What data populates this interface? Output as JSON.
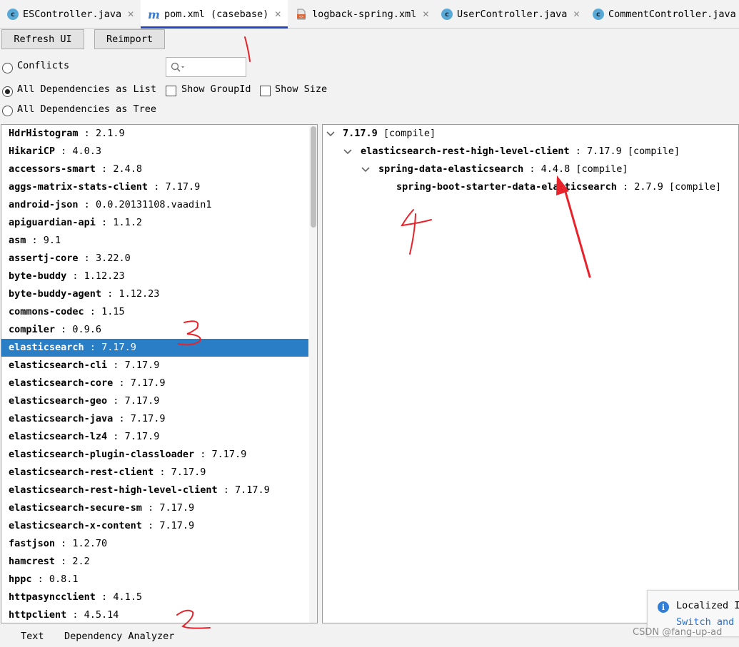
{
  "tabs": [
    {
      "label": "ESController.java",
      "icon": "java-class-icon"
    },
    {
      "label": "pom.xml (casebase)",
      "icon": "maven-icon",
      "active": true
    },
    {
      "label": "logback-spring.xml",
      "icon": "xml-file-icon"
    },
    {
      "label": "UserController.java",
      "icon": "java-class-icon"
    },
    {
      "label": "CommentController.java",
      "icon": "java-class-icon"
    }
  ],
  "toolbar": {
    "refresh_label": "Refresh UI",
    "reimport_label": "Reimport"
  },
  "options": {
    "conflicts": "Conflicts",
    "as_list": "All Dependencies as List",
    "as_tree": "All Dependencies as Tree",
    "show_groupid": "Show GroupId",
    "show_size": "Show Size"
  },
  "dependencies": [
    {
      "name": "HdrHistogram",
      "version": "2.1.9"
    },
    {
      "name": "HikariCP",
      "version": "4.0.3"
    },
    {
      "name": "accessors-smart",
      "version": "2.4.8"
    },
    {
      "name": "aggs-matrix-stats-client",
      "version": "7.17.9"
    },
    {
      "name": "android-json",
      "version": "0.0.20131108.vaadin1"
    },
    {
      "name": "apiguardian-api",
      "version": "1.1.2"
    },
    {
      "name": "asm",
      "version": "9.1"
    },
    {
      "name": "assertj-core",
      "version": "3.22.0"
    },
    {
      "name": "byte-buddy",
      "version": "1.12.23"
    },
    {
      "name": "byte-buddy-agent",
      "version": "1.12.23"
    },
    {
      "name": "commons-codec",
      "version": "1.15"
    },
    {
      "name": "compiler",
      "version": "0.9.6"
    },
    {
      "name": "elasticsearch",
      "version": "7.17.9",
      "selected": true
    },
    {
      "name": "elasticsearch-cli",
      "version": "7.17.9"
    },
    {
      "name": "elasticsearch-core",
      "version": "7.17.9"
    },
    {
      "name": "elasticsearch-geo",
      "version": "7.17.9"
    },
    {
      "name": "elasticsearch-java",
      "version": "7.17.9"
    },
    {
      "name": "elasticsearch-lz4",
      "version": "7.17.9"
    },
    {
      "name": "elasticsearch-plugin-classloader",
      "version": "7.17.9"
    },
    {
      "name": "elasticsearch-rest-client",
      "version": "7.17.9"
    },
    {
      "name": "elasticsearch-rest-high-level-client",
      "version": "7.17.9"
    },
    {
      "name": "elasticsearch-secure-sm",
      "version": "7.17.9"
    },
    {
      "name": "elasticsearch-x-content",
      "version": "7.17.9"
    },
    {
      "name": "fastjson",
      "version": "1.2.70"
    },
    {
      "name": "hamcrest",
      "version": "2.2"
    },
    {
      "name": "hppc",
      "version": "0.8.1"
    },
    {
      "name": "httpasyncclient",
      "version": "4.1.5"
    },
    {
      "name": "httpclient",
      "version": "4.5.14"
    }
  ],
  "tree": {
    "root": {
      "name": "7.17.9",
      "scope": "[compile]"
    },
    "level1": {
      "name": "elasticsearch-rest-high-level-client",
      "version": "7.17.9",
      "scope": "[compile]"
    },
    "level2": {
      "name": "spring-data-elasticsearch",
      "version": "4.4.8",
      "scope": "[compile]"
    },
    "level3": {
      "name": "spring-boot-starter-data-elasticsearch",
      "version": "2.7.9",
      "scope": "[compile]"
    }
  },
  "bottom_tabs": {
    "text": "Text",
    "analyzer": "Dependency Analyzer"
  },
  "notification": {
    "title": "Localized I",
    "link": "Switch and"
  },
  "watermark": "CSDN @fang-up-ad",
  "annotations": [
    "1",
    "2",
    "3",
    "4"
  ],
  "colors": {
    "selection": "#2a7ec5",
    "active_tab_underline": "#1f45c9",
    "annotation_red": "#e8222a"
  }
}
